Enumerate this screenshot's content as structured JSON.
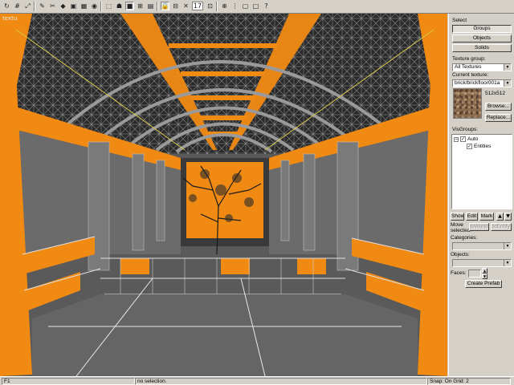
{
  "toolbar": {
    "icons": [
      "rotate-icon",
      "grid-icon",
      "scale-icon",
      "brush-icon",
      "clip-icon",
      "decal-icon",
      "overlay-icon",
      "texture-icon",
      "camera-icon",
      "select-icon",
      "entity-icon",
      "block-icon",
      "group-icon",
      "toggle-groups-icon",
      "texlock-icon",
      "ungroup-icon",
      "carve-icon",
      "grid-size-icon",
      "snap-icon",
      "grid-toggle-icon",
      "cordon-icon",
      "box-icon",
      "help-icon"
    ],
    "zoom_value": "17"
  },
  "viewport": {
    "label": "textu"
  },
  "panel": {
    "select_label": "Select",
    "groups_button": "Groups",
    "objects_button": "Objects",
    "solids_button": "Solids",
    "texture_group_label": "Texture group:",
    "texture_group_value": "All Textures",
    "current_texture_label": "Current texture:",
    "current_texture_value": "brick/brickfloor001a",
    "texture_size": "512x512",
    "browse_button": "Browse...",
    "replace_button": "Replace...",
    "visgroups_label": "VisGroups:",
    "visgroups": [
      {
        "label": "Auto",
        "checked": "✓",
        "expander": "−"
      },
      {
        "label": "Entities",
        "checked": "✓"
      }
    ],
    "show_button": "Show",
    "edit_button": "Edit",
    "mark_button": "Mark",
    "up_arrow": "▲",
    "down_arrow": "▼",
    "move_selected_label": "Move selected:",
    "to_world_button": "toWorld",
    "to_entity_button": "toEntity",
    "categories_label": "Categories:",
    "objects_label": "Objects:",
    "faces_label": "Faces:",
    "create_prefab_button": "Create Prefab"
  },
  "statusbar": {
    "help_key": "F1",
    "selection": "no selection.",
    "snap_grid": "Snap: On Grid: 2"
  },
  "colors": {
    "accent_orange": "#f18a13",
    "face_gray": "#6b6b6b",
    "wire_white": "#e0e0e0"
  }
}
